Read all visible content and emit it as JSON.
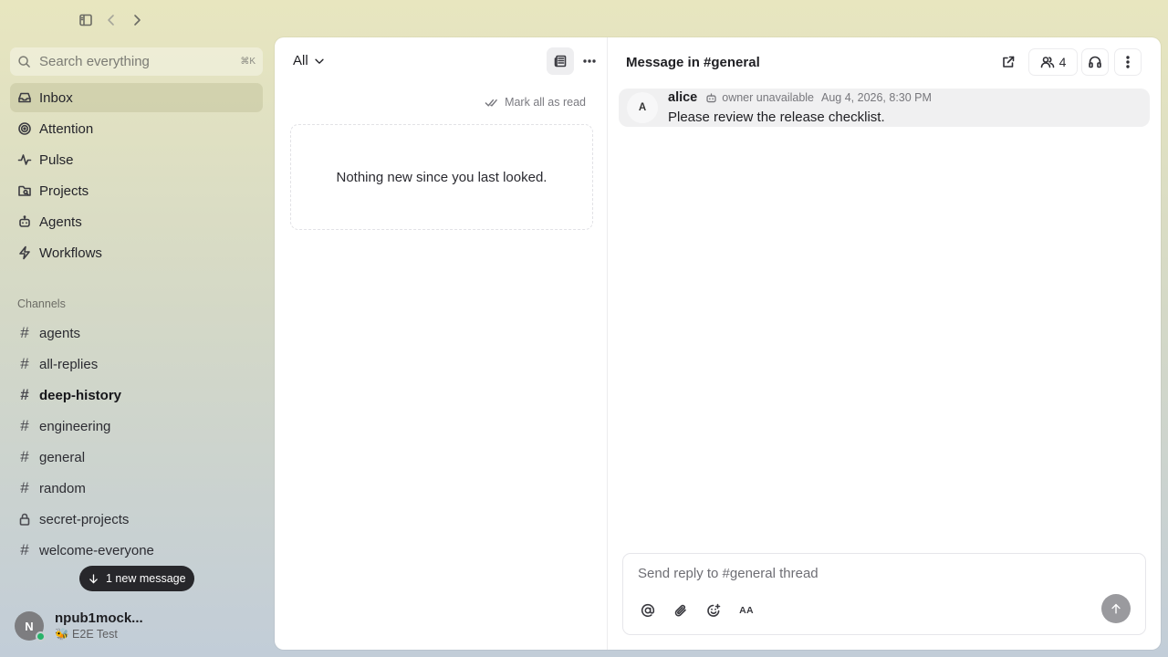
{
  "search": {
    "placeholder": "Search everything",
    "shortcut": "⌘K"
  },
  "nav": [
    {
      "label": "Inbox",
      "icon": "inbox-icon",
      "active": true
    },
    {
      "label": "Attention",
      "icon": "target-icon"
    },
    {
      "label": "Pulse",
      "icon": "pulse-icon"
    },
    {
      "label": "Projects",
      "icon": "projects-icon"
    },
    {
      "label": "Agents",
      "icon": "bot-icon"
    },
    {
      "label": "Workflows",
      "icon": "bolt-icon"
    }
  ],
  "channels_label": "Channels",
  "channels": [
    {
      "name": "agents"
    },
    {
      "name": "all-replies"
    },
    {
      "name": "deep-history",
      "unread": true
    },
    {
      "name": "engineering"
    },
    {
      "name": "general"
    },
    {
      "name": "random"
    },
    {
      "name": "secret-projects",
      "private": true
    },
    {
      "name": "welcome-everyone"
    }
  ],
  "new_message_pill": "1 new message",
  "user": {
    "initial": "N",
    "name": "npub1mock...",
    "status": "🐝 E2E Test",
    "presence_color": "#27b36a"
  },
  "inbox": {
    "filter": "All",
    "mark_all_read": "Mark all as read",
    "empty_text": "Nothing new since you last looked."
  },
  "thread": {
    "title": "Message in #general",
    "member_count": "4",
    "message": {
      "avatar_initial": "A",
      "author": "alice",
      "bot_status": "owner unavailable",
      "timestamp": "Aug 4, 2026, 8:30 PM",
      "text": "Please review the release checklist."
    },
    "composer_placeholder": "Send reply to #general thread",
    "format_label": "AA"
  }
}
